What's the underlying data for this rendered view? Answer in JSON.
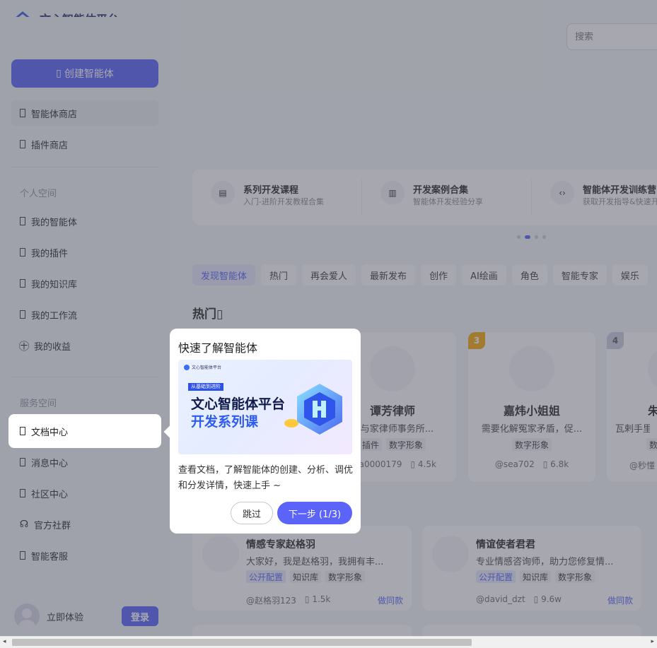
{
  "app": {
    "brand": "文心智能体平台"
  },
  "sidebar": {
    "create_label": "创建智能体",
    "top_items": [
      {
        "label": "智能体商店"
      },
      {
        "label": "插件商店"
      }
    ],
    "personal_title": "个人空间",
    "personal_items": [
      {
        "label": "我的智能体"
      },
      {
        "label": "我的插件"
      },
      {
        "label": "我的知识库"
      },
      {
        "label": "我的工作流"
      },
      {
        "label": "我的收益"
      }
    ],
    "service_title": "服务空间",
    "service_items": [
      {
        "label": "文档中心"
      },
      {
        "label": "消息中心"
      },
      {
        "label": "社区中心"
      },
      {
        "label": "官方社群"
      },
      {
        "label": "智能客服"
      }
    ],
    "user_label": "立即体验",
    "login_label": "登录"
  },
  "search": {
    "placeholder": "搜索"
  },
  "banner": [
    {
      "title": "系列开发课程",
      "sub": "入门-进阶开发教程合集",
      "icon": "doc-icon"
    },
    {
      "title": "开发案例合集",
      "sub": "智能体开发经验分享",
      "icon": "book-icon"
    },
    {
      "title": "智能体开发训练营",
      "sub": "获取开发指导&快速开发体",
      "icon": "code-icon"
    }
  ],
  "tabs": [
    "发现智能体",
    "热门",
    "再会爱人",
    "最新发布",
    "创作",
    "AI绘画",
    "角色",
    "智能专家",
    "娱乐"
  ],
  "hot_title": "热门",
  "hot_cards": [
    {
      "rank": "",
      "name": "谭芳律师",
      "desc": "家与家律师事务所...",
      "tags": [
        "插件",
        "数字形象"
      ],
      "author": "kqa0000179",
      "count": "4.5k"
    },
    {
      "rank": "3",
      "name": "嘉炜小姐姐",
      "desc": "需要化解冤家矛盾，促...",
      "tags": [
        "数字形象"
      ],
      "author": "@sea702",
      "count": "6.8k"
    },
    {
      "rank": "4",
      "name": "朱",
      "desc": "瓦剌手里得",
      "tags": [
        "数"
      ],
      "author": "@秒懂",
      "count": ""
    }
  ],
  "wide_cards": [
    {
      "name": "情感专家赵格羽",
      "desc": "大家好，我是赵格羽，我拥有丰...",
      "tags": [
        "公开配置",
        "知识库",
        "数字形象"
      ],
      "author": "@赵格羽123",
      "count": "1.5k",
      "action": "做同款"
    },
    {
      "name": "情谊使者君君",
      "desc": "专业情感咨询师，助力您修复情...",
      "tags": [
        "公开配置",
        "知识库",
        "数字形象"
      ],
      "author": "@david_dzt",
      "count": "9.6w",
      "action": "做同款"
    }
  ],
  "guide": {
    "title": "快速了解智能体",
    "image": {
      "badge": "从基础到进阶",
      "line1": "文心智能体平台",
      "line2": "开发系列课",
      "mini": "文心智能体平台"
    },
    "text": "查看文档，了解智能体的创建、分析、调优和分发详情，快速上手 ~",
    "skip": "跳过",
    "next": "下一步 (1/3)"
  },
  "colors": {
    "accent": "#4e5bf6",
    "rank3": "#f5a300",
    "rank4": "#c8cbe0"
  }
}
